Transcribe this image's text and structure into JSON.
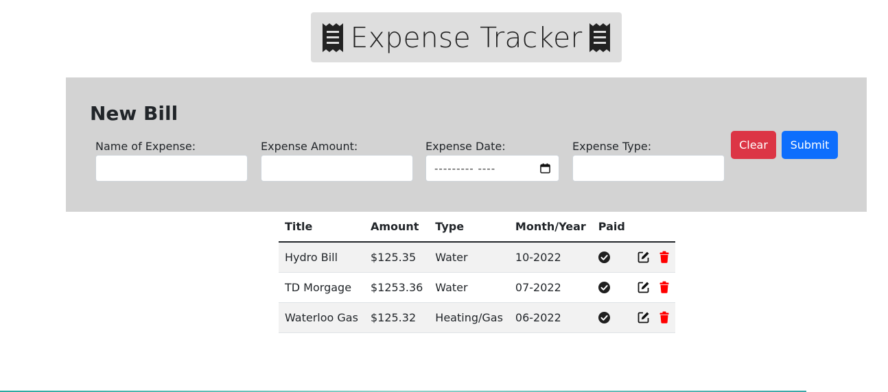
{
  "header": {
    "title": "Expense Tracker",
    "icon_left": "receipt-icon",
    "icon_right": "receipt-icon"
  },
  "form": {
    "heading": "New Bill",
    "name_label": "Name of Expense:",
    "name_value": "",
    "amount_label": "Expense Amount:",
    "amount_value": "",
    "date_label": "Expense Date:",
    "date_placeholder": "--------- ----",
    "date_icon": "calendar-icon",
    "type_label": "Expense Type:",
    "type_value": "",
    "clear_label": "Clear",
    "submit_label": "Submit"
  },
  "table": {
    "columns": [
      "Title",
      "Amount",
      "Type",
      "Month/Year",
      "Paid"
    ],
    "rows": [
      {
        "title": "Hydro Bill",
        "amount": "$125.35",
        "type": "Water",
        "month_year": "10-2022",
        "paid_icon": "check-circle-icon"
      },
      {
        "title": "TD Morgage",
        "amount": "$1253.36",
        "type": "Water",
        "month_year": "07-2022",
        "paid_icon": "check-circle-icon"
      },
      {
        "title": "Waterloo Gas",
        "amount": "$125.32",
        "type": "Heating/Gas",
        "month_year": "06-2022",
        "paid_icon": "check-circle-icon"
      }
    ]
  },
  "colors": {
    "panel_bg": "#d3d3d3",
    "title_bg": "#dedede",
    "clear_button": "#dc3545",
    "submit_button": "#0d6efd",
    "delete_icon": "#ff0000"
  }
}
